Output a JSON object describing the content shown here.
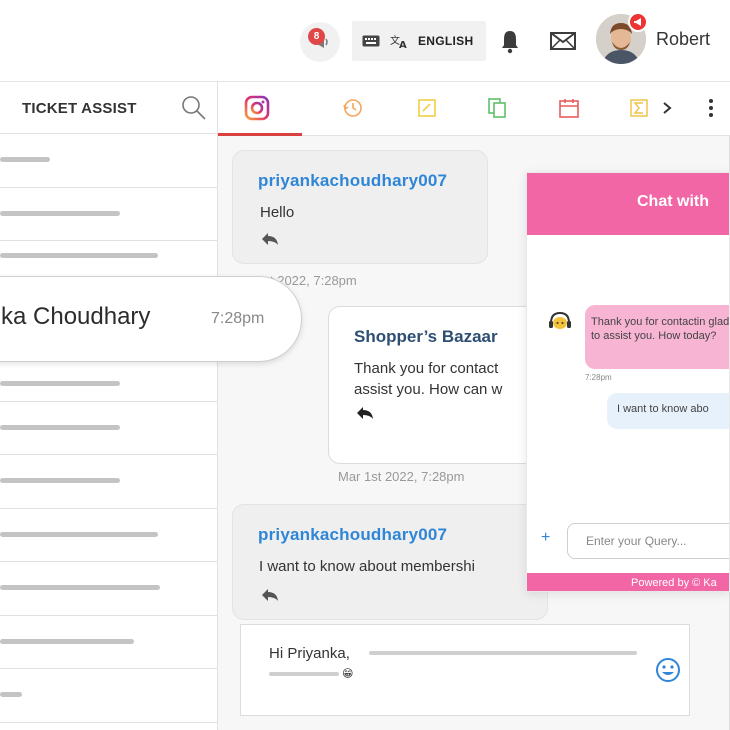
{
  "topbar": {
    "notification_count": "8",
    "language_label": "ENGLISH",
    "user_name": "Robert"
  },
  "left": {
    "title": "TICKET ASSIST",
    "highlight": {
      "name": "ka Choudhary",
      "time": "7:28pm"
    }
  },
  "chat": {
    "msg1": {
      "user": "priyankachoudhary007",
      "text": "Hello"
    },
    "ts1": "t 2022, 7:28pm",
    "msg2": {
      "brand": "Shopper’s Bazaar",
      "line1": "Thank you for contact",
      "line2": "assist you. How can w"
    },
    "ts2": "Mar 1st 2022, 7:28pm",
    "msg3": {
      "user": "priyankachoudhary007",
      "text": "I want to know about membershi"
    },
    "compose_text": "Hi Priyanka,"
  },
  "widget": {
    "title": "Chat with",
    "bot_message": "Thank you for contactin glad to assist you. How today?",
    "bot_time": "7:28pm",
    "user_message": "I want to know abo",
    "input_placeholder": "Enter your Query...",
    "footer": "Powered by © Ka",
    "plus_label": "+"
  },
  "colors": {
    "accent_pink": "#f266a6",
    "link_blue": "#2f86d6",
    "tab_active": "#d94040"
  }
}
